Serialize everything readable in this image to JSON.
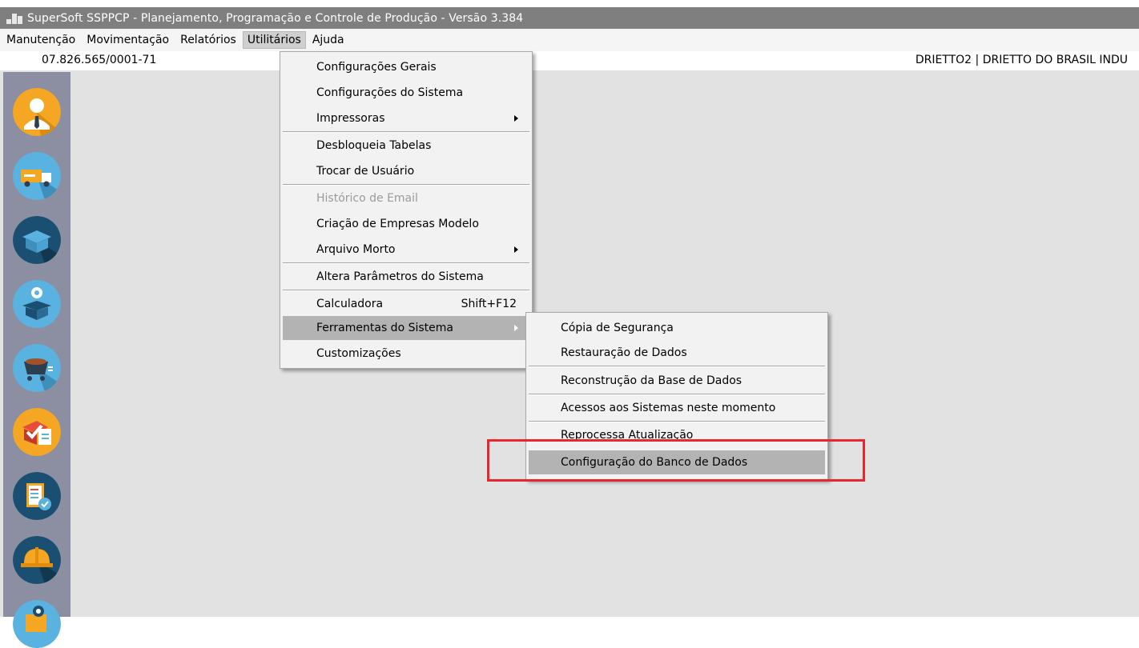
{
  "window": {
    "title": "SuperSoft SSPPCP - Planejamento, Programação e Controle de Produção - Versão 3.384",
    "app_icon": "supersoft-app-icon"
  },
  "menubar": {
    "items": [
      {
        "label": "Manutenção"
      },
      {
        "label": "Movimentação"
      },
      {
        "label": "Relatórios"
      },
      {
        "label": "Utilitários",
        "active": true
      },
      {
        "label": "Ajuda"
      }
    ]
  },
  "infobar": {
    "cnpj": "07.826.565/0001-71",
    "company": "DRIETTO2 | DRIETTO DO BRASIL INDU"
  },
  "sidebar": {
    "icons": [
      {
        "name": "user-icon",
        "color": "#f5a623"
      },
      {
        "name": "truck-icon",
        "color": "#5ab2e0"
      },
      {
        "name": "box-icon",
        "color": "#1b4f72"
      },
      {
        "name": "box-gear-icon",
        "color": "#5ab2e0"
      },
      {
        "name": "cart-icon",
        "color": "#5ab2e0"
      },
      {
        "name": "checklist-icon",
        "color": "#f5a623"
      },
      {
        "name": "document-check-icon",
        "color": "#1b4f72"
      },
      {
        "name": "helmet-icon",
        "color": "#1b4f72"
      },
      {
        "name": "map-pin-icon",
        "color": "#5ab2e0"
      }
    ]
  },
  "utilitarios_menu": {
    "items": [
      {
        "label": "Configurações Gerais"
      },
      {
        "label": "Configurações do Sistema"
      },
      {
        "label": "Impressoras",
        "submenu": true
      },
      {
        "label": "Desbloqueia Tabelas"
      },
      {
        "label": "Trocar de Usuário"
      },
      {
        "label": "Histórico de Email",
        "disabled": true
      },
      {
        "label": "Criação de Empresas Modelo"
      },
      {
        "label": "Arquivo Morto",
        "submenu": true
      },
      {
        "label": "Altera Parâmetros do Sistema"
      },
      {
        "label": "Calculadora",
        "shortcut": "Shift+F12"
      },
      {
        "label": "Ferramentas do Sistema",
        "submenu": true,
        "highlighted": true
      },
      {
        "label": "Customizações"
      }
    ]
  },
  "ferramentas_menu": {
    "items": [
      {
        "label": "Cópia de Segurança"
      },
      {
        "label": "Restauração de Dados"
      },
      {
        "label": "Reconstrução da Base de Dados"
      },
      {
        "label": "Acessos aos Sistemas neste momento"
      },
      {
        "label": "Reprocessa Atualização"
      },
      {
        "label": "Configuração do Banco de Dados",
        "highlighted": true
      }
    ]
  },
  "annotation": {
    "color": "#e8262d"
  },
  "colors": {
    "titlebar": "#7f7f7f",
    "sidebar": "#8c8fa2",
    "workspace": "#e2e2e2",
    "menu_highlight": "#b3b3b3"
  }
}
